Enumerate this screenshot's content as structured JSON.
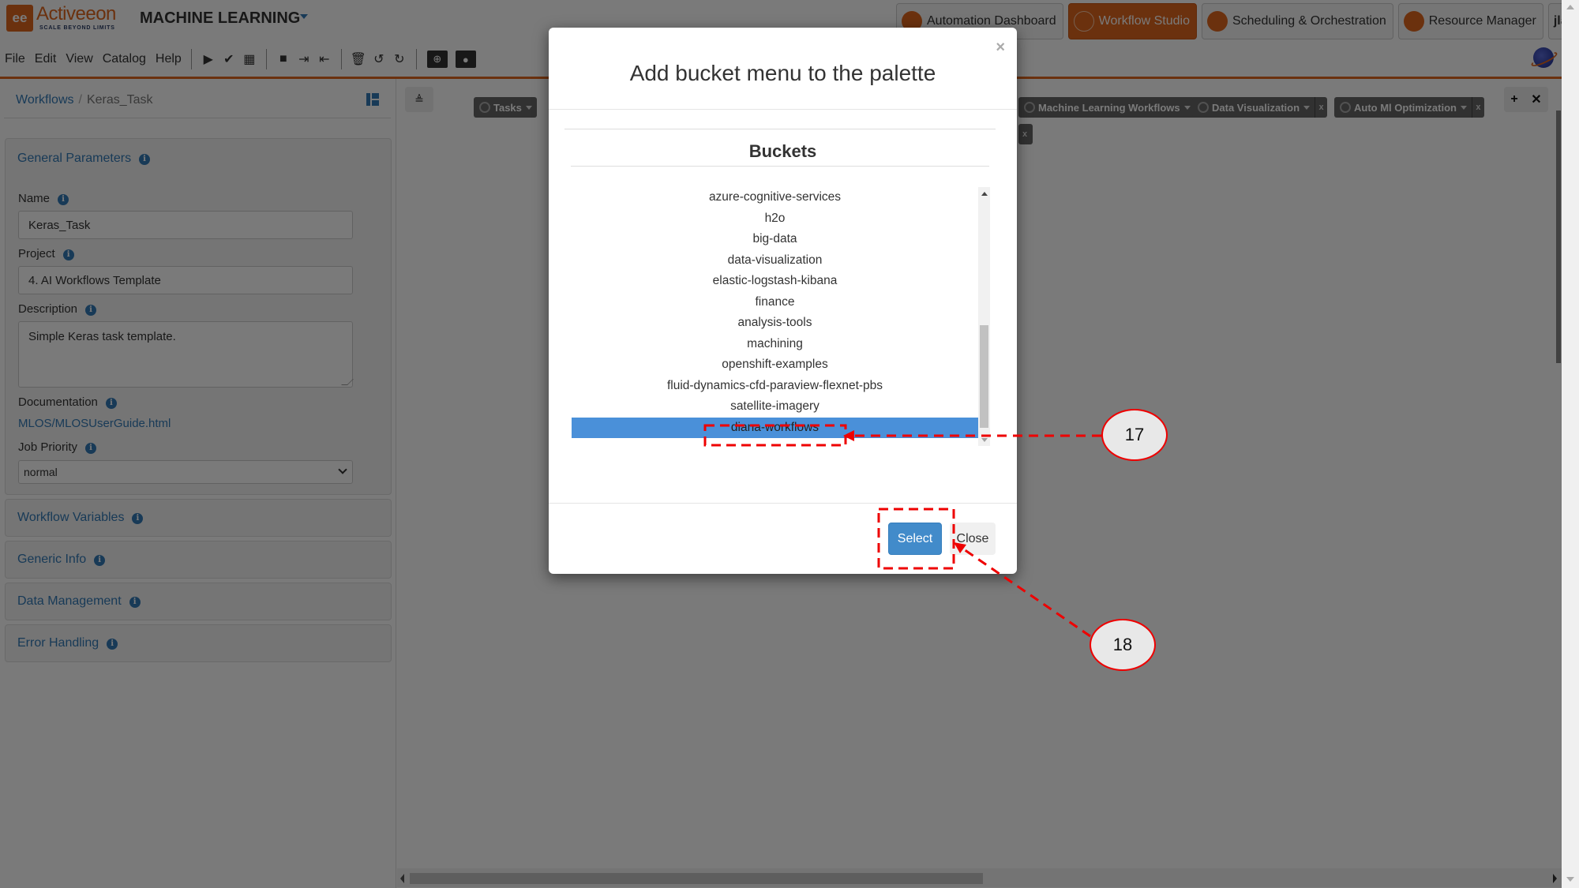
{
  "app": {
    "logo_text": "Activeeon",
    "logo_tagline": "SCALE BEYOND LIMITS",
    "title": "MACHINE LEARNING"
  },
  "portal_tabs": [
    {
      "label": "Automation Dashboard",
      "icon": "dashboard-gauge-icon",
      "active": false
    },
    {
      "label": "Workflow Studio",
      "icon": "workflow-icon",
      "active": true
    },
    {
      "label": "Scheduling & Orchestration",
      "icon": "gears-icon",
      "active": false
    },
    {
      "label": "Resource Manager",
      "icon": "cloud-icon",
      "active": false
    }
  ],
  "user": {
    "name": "jlailaty",
    "logout_icon": "logout-arrow-icon"
  },
  "menu": [
    "File",
    "Edit",
    "View",
    "Catalog",
    "Help"
  ],
  "toolbar_icons": [
    "play-icon",
    "check-icon",
    "calendar-icon",
    "save-icon",
    "import-icon",
    "export-icon",
    "trash-icon",
    "undo-icon",
    "redo-icon",
    "folder-globe-icon",
    "folder-user-icon"
  ],
  "breadcrumb": {
    "root": "Workflows",
    "separator": "/",
    "current": "Keras_Task"
  },
  "general_parameters": {
    "title": "General Parameters",
    "name_label": "Name",
    "name_value": "Keras_Task",
    "project_label": "Project",
    "project_value": "4. AI Workflows Template",
    "description_label": "Description",
    "description_value": "Simple Keras task template.",
    "documentation_label": "Documentation",
    "documentation_link": "MLOS/MLOSUserGuide.html",
    "job_priority_label": "Job Priority",
    "job_priority_value": "normal"
  },
  "collapsed_panels": [
    "Workflow Variables",
    "Generic Info",
    "Data Management",
    "Error Handling"
  ],
  "palette": {
    "chips": [
      {
        "label": "Tasks"
      },
      {
        "label": "Machine Learning Workflows"
      },
      {
        "label": "Data Visualization"
      },
      {
        "label": "Auto Ml Optimization"
      }
    ],
    "close_glyph": "x",
    "add_glyph": "+",
    "unpin_glyph": "✕"
  },
  "modal": {
    "title": "Add bucket menu to the palette",
    "close_glyph": "×",
    "section_title": "Buckets",
    "buckets": [
      "azure-cognitive-services",
      "h2o",
      "big-data",
      "data-visualization",
      "elastic-logstash-kibana",
      "finance",
      "analysis-tools",
      "machining",
      "openshift-examples",
      "fluid-dynamics-cfd-paraview-flexnet-pbs",
      "satellite-imagery",
      "diana-workflows"
    ],
    "selected_bucket": "diana-workflows",
    "select_label": "Select",
    "close_label": "Close"
  },
  "annotations": [
    {
      "number": "17",
      "target": "diana-workflows"
    },
    {
      "number": "18",
      "target": "Select"
    }
  ],
  "colors": {
    "brand_orange": "#e0661f",
    "link_blue": "#337ab7",
    "selection_blue": "#4a90d9",
    "primary_button": "#428bca",
    "annotation_red": "#e00000"
  }
}
